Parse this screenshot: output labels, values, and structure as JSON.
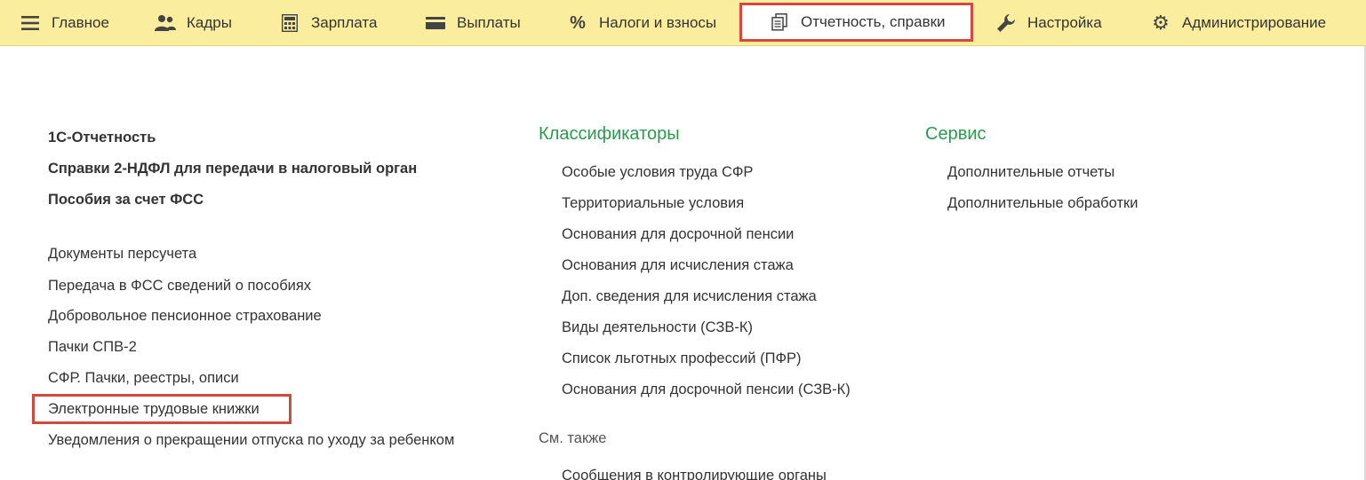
{
  "menu": {
    "items": [
      {
        "label": "Главное",
        "icon": "hamburger-icon"
      },
      {
        "label": "Кадры",
        "icon": "people-icon"
      },
      {
        "label": "Зарплата",
        "icon": "calculator-icon"
      },
      {
        "label": "Выплаты",
        "icon": "wallet-icon"
      },
      {
        "label": "Налоги и взносы",
        "icon": "percent-icon"
      },
      {
        "label": "Отчетность, справки",
        "icon": "documents-icon"
      },
      {
        "label": "Настройка",
        "icon": "wrench-icon"
      },
      {
        "label": "Администрирование",
        "icon": "gear-icon"
      }
    ],
    "active_index": 5
  },
  "column1": {
    "bold_links": [
      "1С-Отчетность",
      "Справки 2-НДФЛ для передачи в налоговый орган",
      "Пособия за счет ФСС"
    ],
    "links": [
      "Документы персучета",
      "Передача в ФСС сведений о пособиях",
      "Добровольное пенсионное страхование",
      "Пачки СПВ-2",
      "СФР. Пачки, реестры, описи",
      "Электронные трудовые книжки",
      "Уведомления о прекращении отпуска по уходу за ребенком"
    ]
  },
  "column2": {
    "title": "Классификаторы",
    "links": [
      "Особые условия труда СФР",
      "Территориальные условия",
      "Основания для досрочной пенсии",
      "Основания для исчисления стажа",
      "Доп. сведения для исчисления стажа",
      "Виды деятельности (СЗВ-К)",
      "Список льготных профессий (ПФР)",
      "Основания для досрочной пенсии (СЗВ-К)"
    ],
    "see_also": "См. также",
    "see_also_links": [
      "Сообщения в контролирующие органы"
    ]
  },
  "column3": {
    "title": "Сервис",
    "links": [
      "Дополнительные отчеты",
      "Дополнительные обработки"
    ]
  }
}
